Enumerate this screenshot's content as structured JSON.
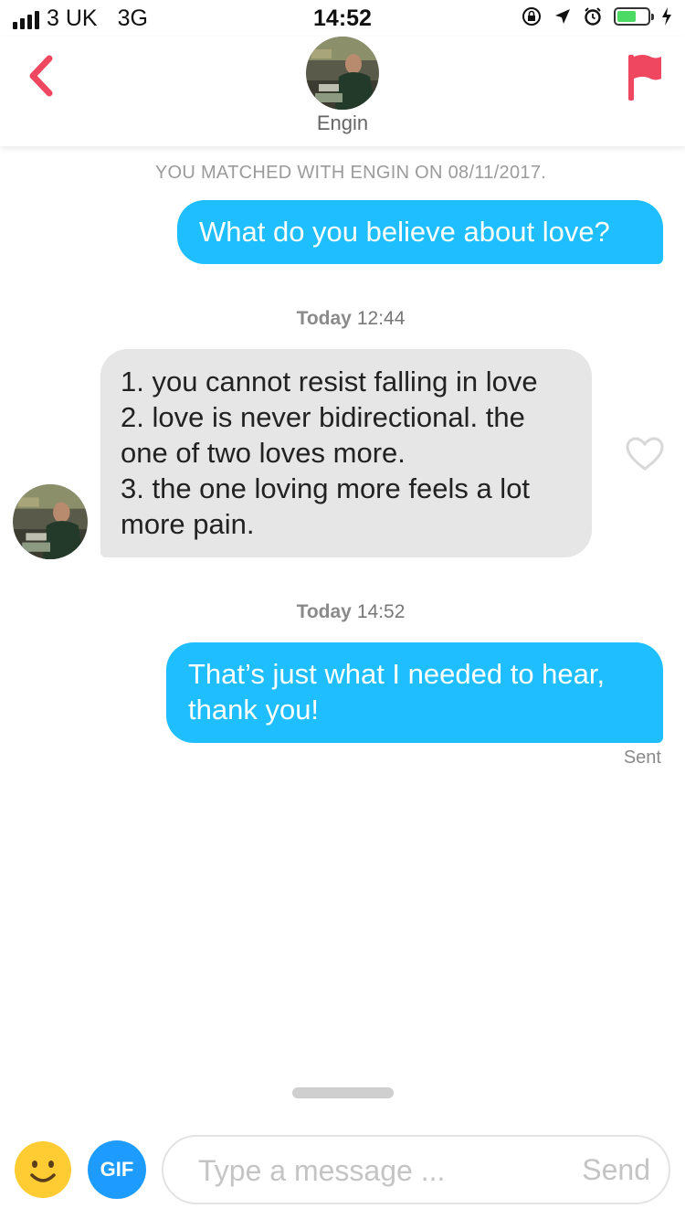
{
  "status_bar": {
    "carrier": "3 UK",
    "network": "3G",
    "time": "14:52",
    "battery_color": "#4cd964"
  },
  "header": {
    "contact_name": "Engin",
    "back_icon": "chevron-left-icon",
    "report_icon": "flag-icon",
    "accent_color": "#ef4760"
  },
  "chat": {
    "match_note": "YOU MATCHED WITH ENGIN ON 08/11/2017.",
    "messages": [
      {
        "direction": "sent",
        "text": "What do you believe about love?"
      },
      {
        "direction": "received",
        "timestamp_day": "Today",
        "timestamp_time": "12:44",
        "lines": [
          "1. you cannot resist falling in love",
          "2. love is never bidirectional. the",
          "one of two loves more.",
          "3. the one loving more feels a lot",
          "more pain."
        ],
        "like_icon": "heart-outline-icon"
      },
      {
        "direction": "sent",
        "timestamp_day": "Today",
        "timestamp_time": "14:52",
        "lines": [
          "That’s just what I needed to hear,",
          "thank you!"
        ],
        "status": "Sent"
      }
    ],
    "sent_bubble_color": "#1fbfff",
    "received_bubble_color": "#e6e6e6"
  },
  "composer": {
    "emoji_icon": "smiley-icon",
    "gif_label": "GIF",
    "placeholder": "Type a message ...",
    "value": "",
    "send_label": "Send"
  }
}
